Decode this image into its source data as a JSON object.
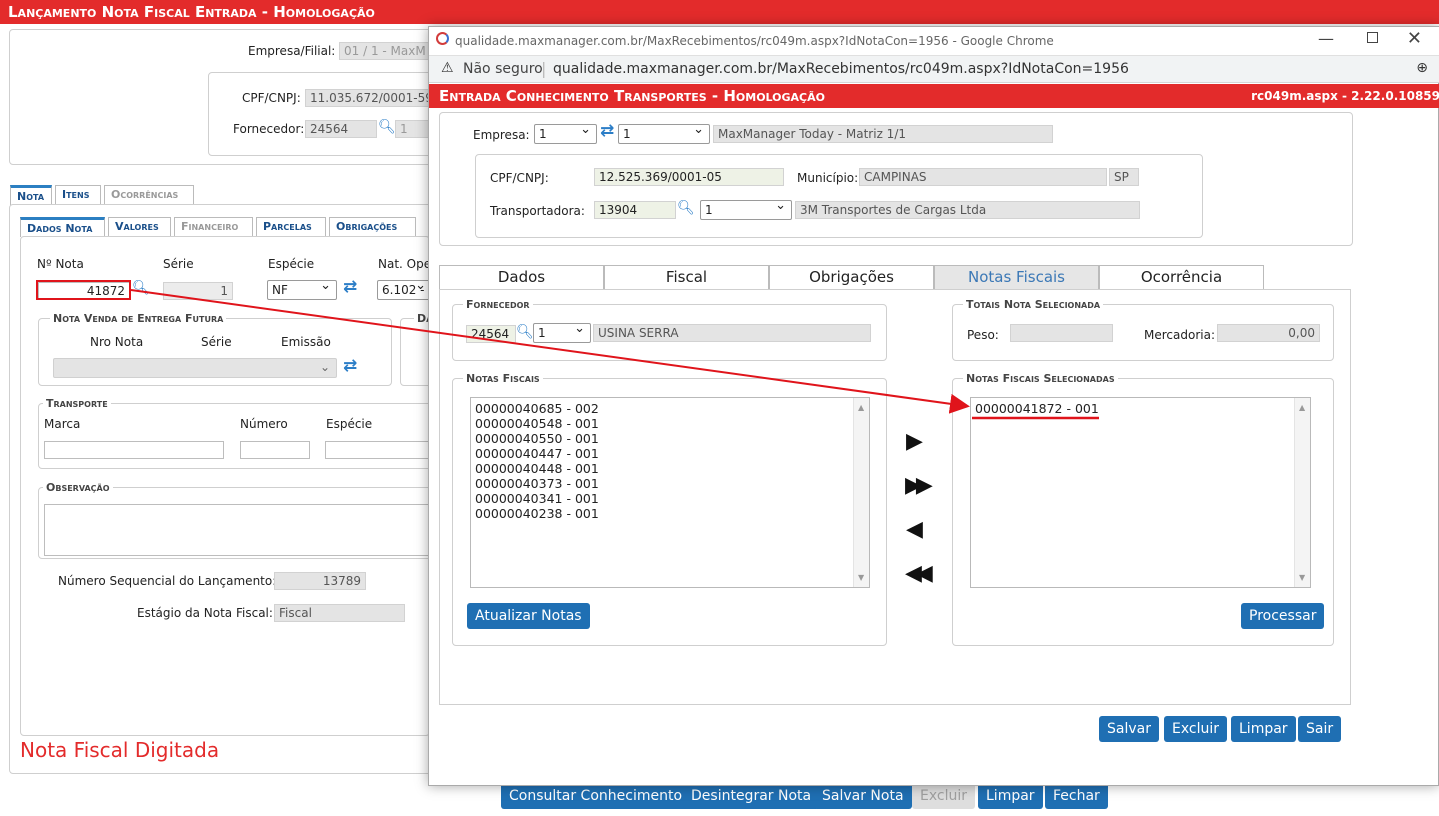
{
  "background": {
    "title_bar": "Lançamento Nota Fiscal Entrada - Homologação",
    "empresa_label": "Empresa/Filial:",
    "empresa_value": "01 / 1 - MaxM",
    "cpf_label": "CPF/CNPJ:",
    "cpf_value": "11.035.672/0001-59",
    "fornecedor_label": "Fornecedor:",
    "fornecedor_code": "24564",
    "fornecedor_sel": "1",
    "tabs": [
      "Nota",
      "Itens",
      "Ocorrências"
    ],
    "subtabs": [
      "Dados Nota",
      "Valores",
      "Financeiro",
      "Parcelas",
      "Obrigações"
    ],
    "nota_label": "Nº Nota",
    "nota_value": "41872",
    "serie_label": "Série",
    "serie_value": "1",
    "especie_label": "Espécie",
    "especie_value": "NF",
    "natop_label": "Nat. Ope",
    "natop_value": "6.102 -",
    "venda_legend": "Nota Venda de Entrega Futura",
    "venda_d_legend": "Da",
    "nro_nota_label": "Nro Nota",
    "serie2_label": "Série",
    "emissao_label": "Emissão",
    "transporte_legend": "Transporte",
    "marca_label": "Marca",
    "numero_label": "Número",
    "especie2_label": "Espécie",
    "observacao_legend": "Observação",
    "seq_label": "Número Sequencial do Lançamento:",
    "seq_value": "13789",
    "estagio_label": "Estágio da Nota Fiscal:",
    "estagio_value": "Fiscal",
    "status_text": "Nota Fiscal Digitada",
    "buttons": [
      "Consultar Conhecimento",
      "Desintegrar Nota",
      "Salvar Nota",
      "Excluir",
      "Limpar",
      "Fechar"
    ]
  },
  "popup": {
    "window_title": "qualidade.maxmanager.com.br/MaxRecebimentos/rc049m.aspx?IdNotaCon=1956 - Google Chrome",
    "not_secure": "Não seguro",
    "url": "qualidade.maxmanager.com.br/MaxRecebimentos/rc049m.aspx?IdNotaCon=1956",
    "title": "Entrada Conhecimento Transportes - Homologação",
    "version": "rc049m.aspx - 2.22.0.10859",
    "empresa_label": "Empresa:",
    "empresa_sel": "1",
    "filial_sel": "1",
    "empresa_name": "MaxManager Today - Matriz 1/1",
    "cpf_label": "CPF/CNPJ:",
    "cpf_value": "12.525.369/0001-05",
    "municipio_label": "Município:",
    "municipio_value": "CAMPINAS",
    "uf_value": "SP",
    "transp_label": "Transportadora:",
    "transp_code": "13904",
    "transp_sel": "1",
    "transp_name": "3M Transportes de Cargas Ltda",
    "tabs": [
      "Dados",
      "Fiscal",
      "Obrigações",
      "Notas Fiscais",
      "Ocorrência"
    ],
    "fornecedor_legend": "Fornecedor",
    "forn_code": "24564",
    "forn_sel": "1",
    "forn_name": "USINA SERRA",
    "totais_legend": "Totais Nota Selecionada",
    "peso_label": "Peso:",
    "peso_value": "",
    "mercadoria_label": "Mercadoria:",
    "mercadoria_value": "0,00",
    "notas_legend": "Notas Fiscais",
    "notas": [
      "00000040685 - 002",
      "00000040548 - 001",
      "00000040550 - 001",
      "00000040447 - 001",
      "00000040448 - 001",
      "00000040373 - 001",
      "00000040341 - 001",
      "00000040238 - 001"
    ],
    "selecionadas_legend": "Notas Fiscais Selecionadas",
    "selecionadas": [
      "00000041872 - 001"
    ],
    "atualizar_button": "Atualizar Notas",
    "processar_button": "Processar",
    "footer_buttons": [
      "Salvar",
      "Excluir",
      "Limpar",
      "Sair"
    ]
  },
  "colors": {
    "header_red": "#e32b2b",
    "button_blue": "#1f6fb3",
    "annotation_red": "#e0141b"
  }
}
